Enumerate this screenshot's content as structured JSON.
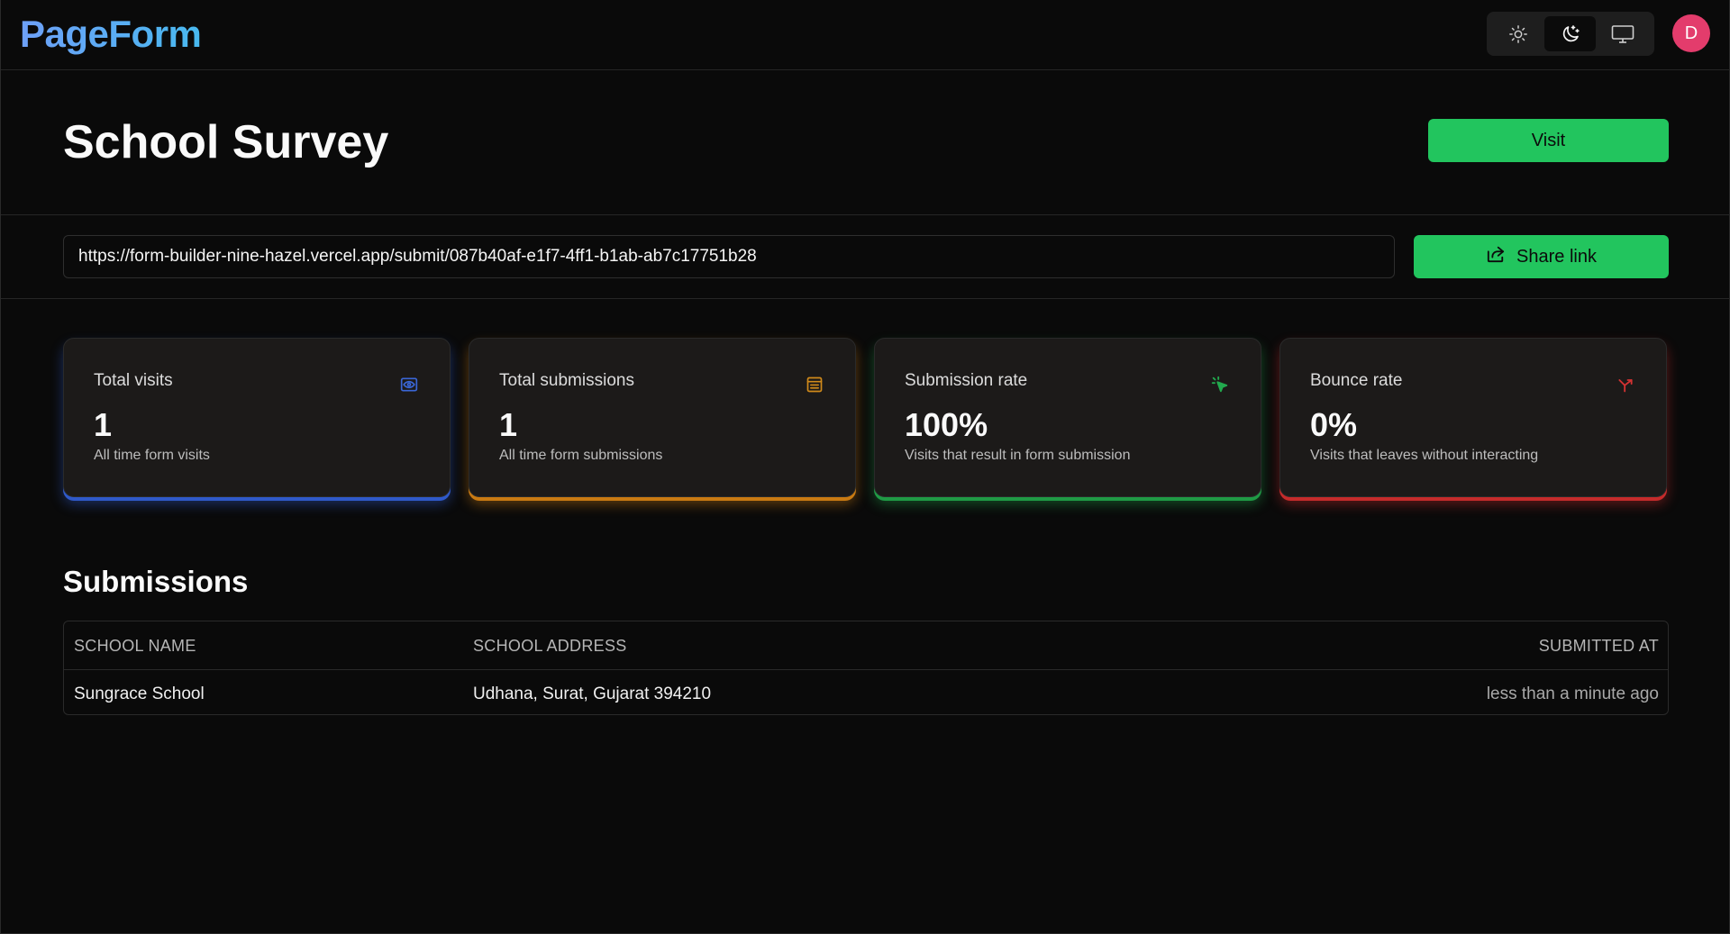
{
  "app": {
    "logo": "PageForm",
    "avatar_initial": "D",
    "theme_options": [
      {
        "name": "light",
        "icon": "sun-icon",
        "active": false
      },
      {
        "name": "dark",
        "icon": "moon-stars-icon",
        "active": true
      },
      {
        "name": "system",
        "icon": "monitor-icon",
        "active": false
      }
    ],
    "accent": "#22c55e"
  },
  "header": {
    "title": "School Survey",
    "visit_label": "Visit"
  },
  "share": {
    "url": "https://form-builder-nine-hazel.vercel.app/submit/087b40af-e1f7-4ff1-b1ab-ab7c17751b28",
    "button_label": "Share link",
    "icon": "share-icon"
  },
  "stats": [
    {
      "title": "Total visits",
      "value": "1",
      "desc": "All time form visits",
      "icon": "eye-icon",
      "color": "#2f59c9"
    },
    {
      "title": "Total submissions",
      "value": "1",
      "desc": "All time form submissions",
      "icon": "form-icon",
      "color": "#d08a1a"
    },
    {
      "title": "Submission rate",
      "value": "100%",
      "desc": "Visits that result in form submission",
      "icon": "cursor-click-icon",
      "color": "#22a94e"
    },
    {
      "title": "Bounce rate",
      "value": "0%",
      "desc": "Visits that leaves without interacting",
      "icon": "split-arrow-icon",
      "color": "#d33232"
    }
  ],
  "submissions": {
    "title": "Submissions",
    "columns": [
      "SCHOOL NAME",
      "SCHOOL ADDRESS",
      "SUBMITTED AT"
    ],
    "rows": [
      [
        "Sungrace School",
        "Udhana, Surat, Gujarat 394210",
        "less than a minute ago"
      ]
    ]
  }
}
